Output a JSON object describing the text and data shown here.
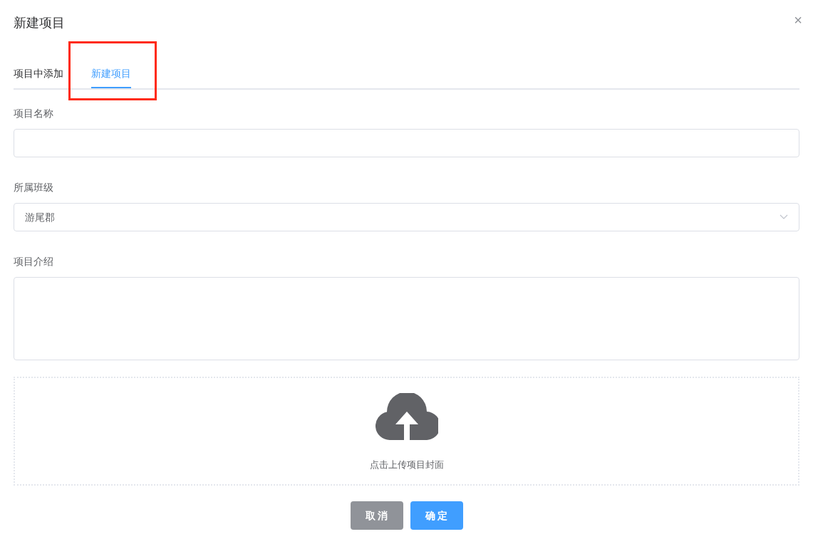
{
  "dialog": {
    "title": "新建项目",
    "close": "×"
  },
  "tabs": [
    {
      "label": "项目中添加",
      "selected": false,
      "highlighted": false
    },
    {
      "label": "新建项目",
      "selected": true,
      "highlighted": true
    }
  ],
  "form": {
    "name": {
      "label": "项目名称"
    },
    "class": {
      "label": "所属班级",
      "value": "游尾郡"
    },
    "intro": {
      "label": "项目介绍"
    }
  },
  "upload": {
    "text": "点击上传项目封面"
  },
  "buttons": [
    {
      "label": "取 消",
      "kind": "secondary"
    },
    {
      "label": "确 定",
      "kind": "primary"
    }
  ]
}
